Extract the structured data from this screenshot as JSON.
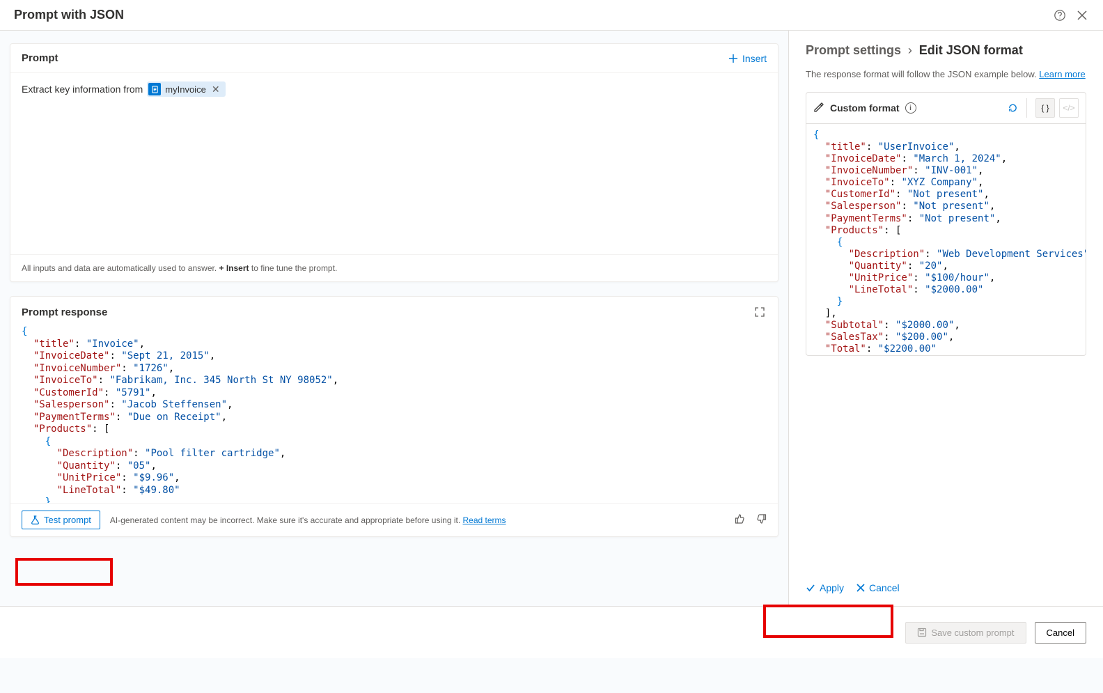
{
  "header": {
    "title": "Prompt with JSON"
  },
  "prompt": {
    "title": "Prompt",
    "insert_label": "Insert",
    "text_prefix": "Extract key information from",
    "chip_label": "myInvoice",
    "hint_before": "All inputs and data are automatically used to answer. ",
    "hint_bold": "+ Insert",
    "hint_after": " to fine tune the prompt."
  },
  "response": {
    "title": "Prompt response",
    "test_label": "Test prompt",
    "disclaimer": "AI-generated content may be incorrect. Make sure it's accurate and appropriate before using it. ",
    "read_terms": "Read terms",
    "json_lines": [
      [
        [
          "brc",
          "{"
        ]
      ],
      [
        [
          "pun",
          "  "
        ],
        [
          "key",
          "\"title\""
        ],
        [
          "pun",
          ": "
        ],
        [
          "str",
          "\"Invoice\""
        ],
        [
          "pun",
          ","
        ]
      ],
      [
        [
          "pun",
          "  "
        ],
        [
          "key",
          "\"InvoiceDate\""
        ],
        [
          "pun",
          ": "
        ],
        [
          "str",
          "\"Sept 21, 2015\""
        ],
        [
          "pun",
          ","
        ]
      ],
      [
        [
          "pun",
          "  "
        ],
        [
          "key",
          "\"InvoiceNumber\""
        ],
        [
          "pun",
          ": "
        ],
        [
          "str",
          "\"1726\""
        ],
        [
          "pun",
          ","
        ]
      ],
      [
        [
          "pun",
          "  "
        ],
        [
          "key",
          "\"InvoiceTo\""
        ],
        [
          "pun",
          ": "
        ],
        [
          "str",
          "\"Fabrikam, Inc. 345 North St NY 98052\""
        ],
        [
          "pun",
          ","
        ]
      ],
      [
        [
          "pun",
          "  "
        ],
        [
          "key",
          "\"CustomerId\""
        ],
        [
          "pun",
          ": "
        ],
        [
          "str",
          "\"5791\""
        ],
        [
          "pun",
          ","
        ]
      ],
      [
        [
          "pun",
          "  "
        ],
        [
          "key",
          "\"Salesperson\""
        ],
        [
          "pun",
          ": "
        ],
        [
          "str",
          "\"Jacob Steffensen\""
        ],
        [
          "pun",
          ","
        ]
      ],
      [
        [
          "pun",
          "  "
        ],
        [
          "key",
          "\"PaymentTerms\""
        ],
        [
          "pun",
          ": "
        ],
        [
          "str",
          "\"Due on Receipt\""
        ],
        [
          "pun",
          ","
        ]
      ],
      [
        [
          "pun",
          "  "
        ],
        [
          "key",
          "\"Products\""
        ],
        [
          "pun",
          ": ["
        ]
      ],
      [
        [
          "pun",
          "    "
        ],
        [
          "brc",
          "{"
        ]
      ],
      [
        [
          "pun",
          "      "
        ],
        [
          "key",
          "\"Description\""
        ],
        [
          "pun",
          ": "
        ],
        [
          "str",
          "\"Pool filter cartridge\""
        ],
        [
          "pun",
          ","
        ]
      ],
      [
        [
          "pun",
          "      "
        ],
        [
          "key",
          "\"Quantity\""
        ],
        [
          "pun",
          ": "
        ],
        [
          "str",
          "\"05\""
        ],
        [
          "pun",
          ","
        ]
      ],
      [
        [
          "pun",
          "      "
        ],
        [
          "key",
          "\"UnitPrice\""
        ],
        [
          "pun",
          ": "
        ],
        [
          "str",
          "\"$9.96\""
        ],
        [
          "pun",
          ","
        ]
      ],
      [
        [
          "pun",
          "      "
        ],
        [
          "key",
          "\"LineTotal\""
        ],
        [
          "pun",
          ": "
        ],
        [
          "str",
          "\"$49.80\""
        ]
      ],
      [
        [
          "pun",
          "    "
        ],
        [
          "brc",
          "}"
        ],
        [
          "pun",
          ","
        ]
      ]
    ]
  },
  "settings": {
    "crumb_parent": "Prompt settings",
    "crumb_current": "Edit JSON format",
    "desc": "The response format will follow the JSON example below. ",
    "learn_more": "Learn more",
    "format_title": "Custom format",
    "apply": "Apply",
    "cancel": "Cancel",
    "json_lines": [
      [
        [
          "brc",
          "{"
        ]
      ],
      [
        [
          "pun",
          "  "
        ],
        [
          "key",
          "\"title\""
        ],
        [
          "pun",
          ": "
        ],
        [
          "str",
          "\"UserInvoice\""
        ],
        [
          "pun",
          ","
        ]
      ],
      [
        [
          "pun",
          "  "
        ],
        [
          "key",
          "\"InvoiceDate\""
        ],
        [
          "pun",
          ": "
        ],
        [
          "str",
          "\"March 1, 2024\""
        ],
        [
          "pun",
          ","
        ]
      ],
      [
        [
          "pun",
          "  "
        ],
        [
          "key",
          "\"InvoiceNumber\""
        ],
        [
          "pun",
          ": "
        ],
        [
          "str",
          "\"INV-001\""
        ],
        [
          "pun",
          ","
        ]
      ],
      [
        [
          "pun",
          "  "
        ],
        [
          "key",
          "\"InvoiceTo\""
        ],
        [
          "pun",
          ": "
        ],
        [
          "str",
          "\"XYZ Company\""
        ],
        [
          "pun",
          ","
        ]
      ],
      [
        [
          "pun",
          "  "
        ],
        [
          "key",
          "\"CustomerId\""
        ],
        [
          "pun",
          ": "
        ],
        [
          "str",
          "\"Not present\""
        ],
        [
          "pun",
          ","
        ]
      ],
      [
        [
          "pun",
          "  "
        ],
        [
          "key",
          "\"Salesperson\""
        ],
        [
          "pun",
          ": "
        ],
        [
          "str",
          "\"Not present\""
        ],
        [
          "pun",
          ","
        ]
      ],
      [
        [
          "pun",
          "  "
        ],
        [
          "key",
          "\"PaymentTerms\""
        ],
        [
          "pun",
          ": "
        ],
        [
          "str",
          "\"Not present\""
        ],
        [
          "pun",
          ","
        ]
      ],
      [
        [
          "pun",
          "  "
        ],
        [
          "key",
          "\"Products\""
        ],
        [
          "pun",
          ": ["
        ]
      ],
      [
        [
          "pun",
          "    "
        ],
        [
          "brc",
          "{"
        ]
      ],
      [
        [
          "pun",
          "      "
        ],
        [
          "key",
          "\"Description\""
        ],
        [
          "pun",
          ": "
        ],
        [
          "str",
          "\"Web Development Services\""
        ],
        [
          "pun",
          ","
        ]
      ],
      [
        [
          "pun",
          "      "
        ],
        [
          "key",
          "\"Quantity\""
        ],
        [
          "pun",
          ": "
        ],
        [
          "str",
          "\"20\""
        ],
        [
          "pun",
          ","
        ]
      ],
      [
        [
          "pun",
          "      "
        ],
        [
          "key",
          "\"UnitPrice\""
        ],
        [
          "pun",
          ": "
        ],
        [
          "str",
          "\"$100/hour\""
        ],
        [
          "pun",
          ","
        ]
      ],
      [
        [
          "pun",
          "      "
        ],
        [
          "key",
          "\"LineTotal\""
        ],
        [
          "pun",
          ": "
        ],
        [
          "str",
          "\"$2000.00\""
        ]
      ],
      [
        [
          "pun",
          "    "
        ],
        [
          "brc",
          "}"
        ]
      ],
      [
        [
          "pun",
          "  ],"
        ]
      ],
      [
        [
          "pun",
          "  "
        ],
        [
          "key",
          "\"Subtotal\""
        ],
        [
          "pun",
          ": "
        ],
        [
          "str",
          "\"$2000.00\""
        ],
        [
          "pun",
          ","
        ]
      ],
      [
        [
          "pun",
          "  "
        ],
        [
          "key",
          "\"SalesTax\""
        ],
        [
          "pun",
          ": "
        ],
        [
          "str",
          "\"$200.00\""
        ],
        [
          "pun",
          ","
        ]
      ],
      [
        [
          "pun",
          "  "
        ],
        [
          "key",
          "\"Total\""
        ],
        [
          "pun",
          ": "
        ],
        [
          "str",
          "\"$2200.00\""
        ]
      ],
      [
        [
          "brc",
          "}"
        ]
      ]
    ]
  },
  "footer": {
    "save": "Save custom prompt",
    "cancel": "Cancel"
  }
}
